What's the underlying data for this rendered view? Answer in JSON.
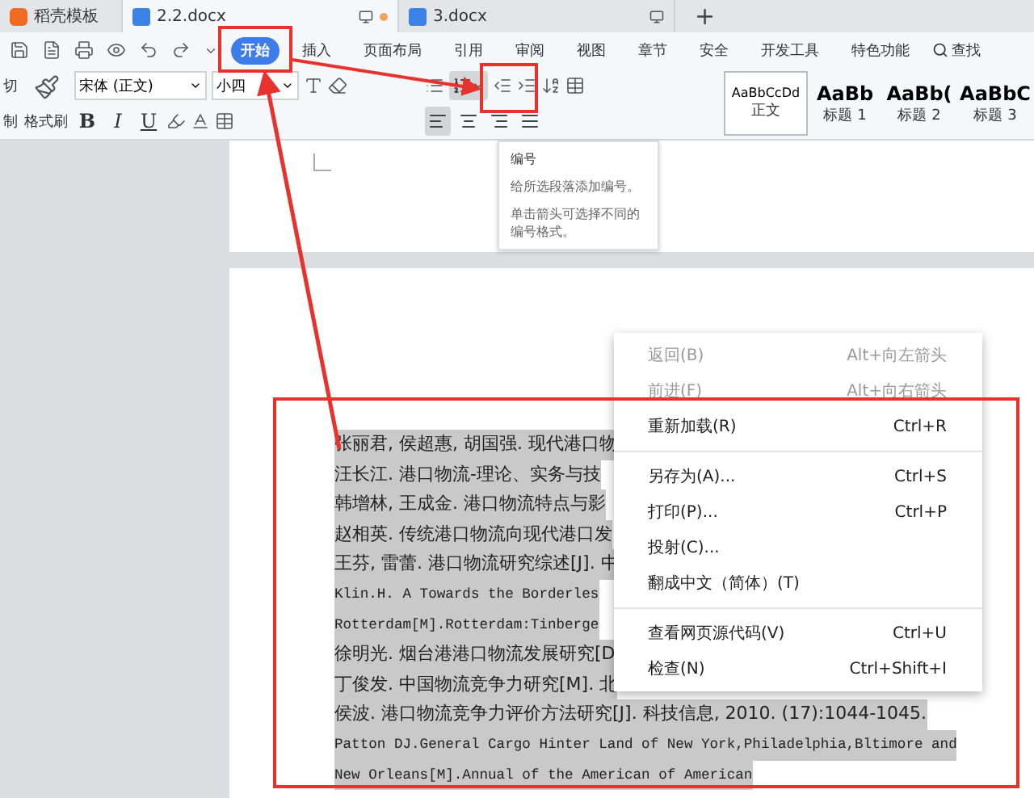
{
  "tabs": [
    {
      "label": "稻壳模板",
      "kind": "home",
      "selected": false
    },
    {
      "label": "2.2.docx",
      "kind": "doc",
      "selected": true
    },
    {
      "label": "3.docx",
      "kind": "doc",
      "selected": false
    }
  ],
  "new_tab": "+",
  "menu": [
    {
      "label": "开始",
      "selected": true
    },
    {
      "label": "插入",
      "selected": false
    },
    {
      "label": "页面布局",
      "selected": false
    },
    {
      "label": "引用",
      "selected": false
    },
    {
      "label": "审阅",
      "selected": false
    },
    {
      "label": "视图",
      "selected": false
    },
    {
      "label": "章节",
      "selected": false
    },
    {
      "label": "安全",
      "selected": false
    },
    {
      "label": "开发工具",
      "selected": false
    },
    {
      "label": "特色功能",
      "selected": false
    }
  ],
  "search": "查找",
  "clipboard": {
    "cut": "切",
    "copy": "制",
    "format_painter": "格式刷"
  },
  "font": {
    "family": "宋体 (正文)",
    "size": "小四"
  },
  "format_buttons": [
    "B",
    "I",
    "U"
  ],
  "alignment": [
    {
      "selected": true
    },
    {
      "selected": false
    },
    {
      "selected": false
    },
    {
      "selected": false
    }
  ],
  "styles": [
    {
      "sample": "AaBbCcDd",
      "name": "正文",
      "selected": true
    },
    {
      "sample": "AaBb",
      "name": "标题 1",
      "selected": false
    },
    {
      "sample": "AaBb(",
      "name": "标题 2",
      "selected": false
    },
    {
      "sample": "AaBbC",
      "name": "标题 3",
      "selected": false
    }
  ],
  "tooltip": {
    "title": "编号",
    "lines": [
      "给所选段落添加编号。",
      "单击箭头可选择不同的编号格式。"
    ]
  },
  "document": {
    "lines": [
      {
        "text": "张丽君, 侯超惠, 胡国强. 现代港口物",
        "kind": "cjk"
      },
      {
        "text": "汪长江. 港口物流-理论、实务与技",
        "kind": "cjk"
      },
      {
        "text": "韩增林, 王成金. 港口物流特点与影",
        "kind": "cjk"
      },
      {
        "text": "赵相英. 传统港口物流向现代港口发",
        "kind": "cjk"
      },
      {
        "text": "王芬, 雷蕾. 港口物流研究综述[J]. 中",
        "kind": "cjk"
      },
      {
        "text": "Klin.H. A Towards the Borderles",
        "kind": "latin"
      },
      {
        "text": "Rotterdam[M].Rotterdam:Tinberge",
        "kind": "latin"
      },
      {
        "text": "徐明光. 烟台港港口物流发展研究[D",
        "kind": "cjk"
      },
      {
        "text": "丁俊发. 中国物流竞争力研究[M]. 北",
        "kind": "cjk"
      },
      {
        "text": "侯波. 港口物流竞争力评价方法研究[J]. 科技信息, 2010. (17):1044-1045.",
        "kind": "cjk"
      },
      {
        "text": "Patton DJ.General Cargo Hinter Land of New York,Philadelphia,Bltimore and",
        "kind": "latin"
      },
      {
        "text": "New Orleans[M].Annual of the American of American",
        "kind": "latin"
      }
    ]
  },
  "context_menu": {
    "groups": [
      [
        {
          "label": "返回(B)",
          "shortcut": "Alt+向左箭头",
          "disabled": true
        },
        {
          "label": "前进(F)",
          "shortcut": "Alt+向右箭头",
          "disabled": true
        },
        {
          "label": "重新加载(R)",
          "shortcut": "Ctrl+R",
          "disabled": false
        }
      ],
      [
        {
          "label": "另存为(A)...",
          "shortcut": "Ctrl+S",
          "disabled": false
        },
        {
          "label": "打印(P)...",
          "shortcut": "Ctrl+P",
          "disabled": false
        },
        {
          "label": "投射(C)...",
          "disabled": false
        },
        {
          "label": "翻成中文（简体）(T)",
          "disabled": false
        }
      ],
      [
        {
          "label": "查看网页源代码(V)",
          "shortcut": "Ctrl+U",
          "disabled": false
        },
        {
          "label": "检查(N)",
          "shortcut": "Ctrl+Shift+I",
          "disabled": false
        }
      ]
    ]
  }
}
